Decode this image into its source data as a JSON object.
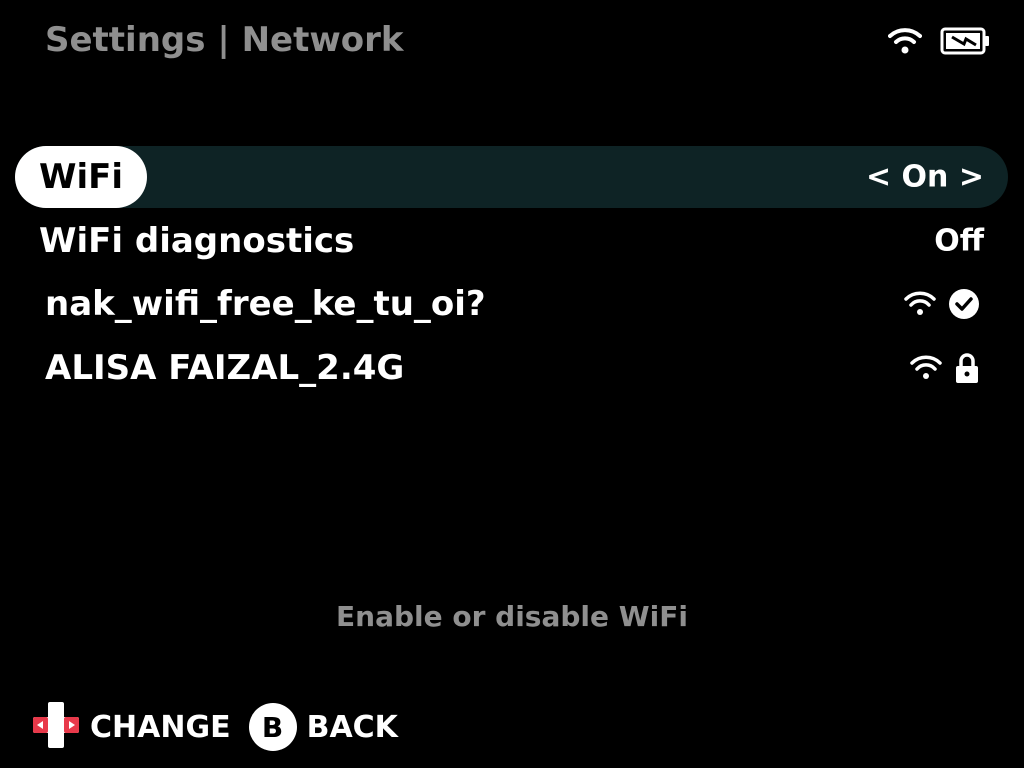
{
  "header": {
    "title": "Settings | Network"
  },
  "status_bar": {
    "wifi_icon": "wifi-icon",
    "battery_icon": "battery-charging-icon"
  },
  "rows": [
    {
      "label": "WiFi",
      "value": "< On >",
      "selected": true
    },
    {
      "label": "WiFi diagnostics",
      "value": "Off",
      "selected": false
    },
    {
      "label": "nak_wifi_free_ke_tu_oi?",
      "icons": [
        "wifi-signal-icon",
        "connected-check-icon"
      ],
      "selected": false
    },
    {
      "label": "ALISA FAIZAL_2.4G",
      "icons": [
        "wifi-signal-icon",
        "lock-icon"
      ],
      "selected": false
    }
  ],
  "hint": "Enable or disable WiFi",
  "footer": {
    "change_label": "CHANGE",
    "change_icon": "dpad-icon",
    "back_button": "B",
    "back_label": "BACK"
  },
  "colors": {
    "background": "#000000",
    "selected_row_bg": "#0e2325",
    "muted_text": "#8f8f8f",
    "dpad_accent": "#e8394a"
  }
}
